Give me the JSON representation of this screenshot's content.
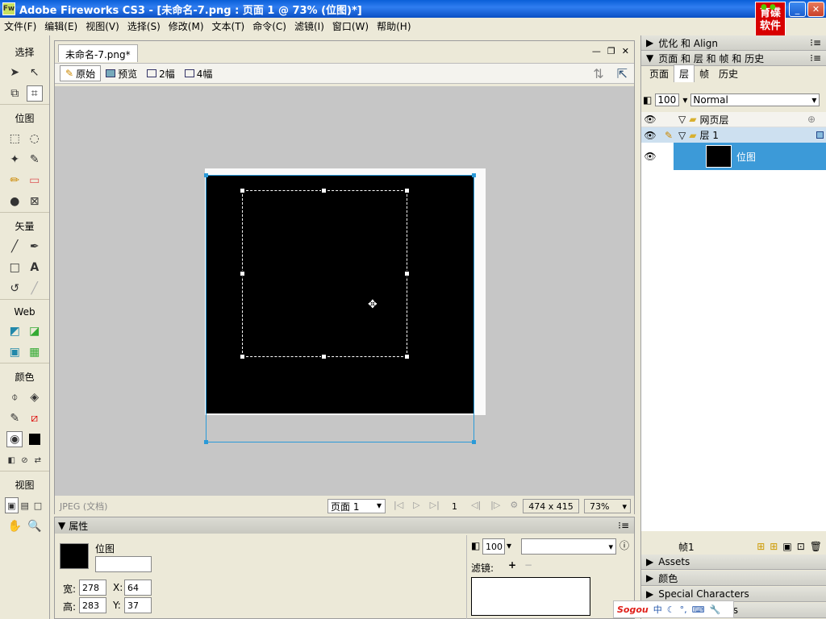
{
  "app": {
    "icon": "Fw",
    "title": "Adobe Fireworks CS3 - [未命名-7.png : 页面 1 @ 73% (位图)*]"
  },
  "logo": {
    "line1": "育碟",
    "line2": "软件"
  },
  "menu": [
    "文件(F)",
    "编辑(E)",
    "视图(V)",
    "选择(S)",
    "修改(M)",
    "文本(T)",
    "命令(C)",
    "滤镜(I)",
    "窗口(W)",
    "帮助(H)"
  ],
  "tools": {
    "sections": [
      "选择",
      "位图",
      "矢量",
      "Web",
      "颜色",
      "视图"
    ]
  },
  "document": {
    "tab": "未命名-7.png*",
    "views": [
      "原始",
      "预览",
      "2幅",
      "4幅"
    ],
    "format": "JPEG (文档)",
    "page_select": "页面 1",
    "frame_num": "1",
    "dimensions": "474 x 415",
    "zoom": "73%"
  },
  "properties": {
    "title": "属性",
    "object_label": "位图",
    "w_label": "宽:",
    "w_value": "278",
    "h_label": "高:",
    "h_value": "283",
    "x_label": "X:",
    "x_value": "64",
    "y_label": "Y:",
    "y_value": "37",
    "opacity": "100",
    "filters_label": "滤镜:"
  },
  "right_panel": {
    "optimize_header": "优化 和 Align",
    "pages_header": "页面 和 层 和 帧 和 历史",
    "tabs": [
      "页面",
      "层",
      "帧",
      "历史"
    ],
    "opacity": "100",
    "blend": "Normal",
    "layers": [
      {
        "name": "网页层"
      },
      {
        "name": "层 1"
      },
      {
        "name": "位图"
      }
    ],
    "frame_label": "帧1",
    "assets": "Assets",
    "colors": "颜色",
    "special_chars": "Special Characters",
    "last_panel": "ties"
  },
  "ime": {
    "brand": "Sogou",
    "mode": "中"
  },
  "colors": {
    "selection": "#2a9ad8",
    "layer_highlight": "#3c9ad8"
  }
}
